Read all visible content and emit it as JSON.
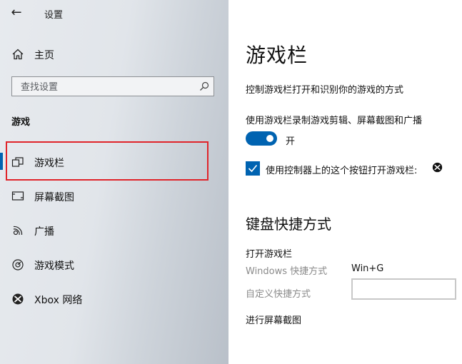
{
  "window": {
    "title": "设置"
  },
  "sidebar": {
    "home_label": "主页",
    "search_placeholder": "查找设置",
    "section_title": "游戏",
    "items": [
      {
        "label": "游戏栏",
        "icon": "game-bar-icon",
        "active": true
      },
      {
        "label": "屏幕截图",
        "icon": "captures-icon"
      },
      {
        "label": "广播",
        "icon": "broadcast-icon"
      },
      {
        "label": "游戏模式",
        "icon": "game-mode-icon"
      },
      {
        "label": "Xbox 网络",
        "icon": "xbox-icon"
      }
    ]
  },
  "content": {
    "title": "游戏栏",
    "description": "控制游戏栏打开和识别你的游戏的方式",
    "toggle_label": "使用游戏栏录制游戏剪辑、屏幕截图和广播",
    "toggle_state": "开",
    "checkbox_label": "使用控制器上的这个按钮打开游戏栏:",
    "shortcuts_heading": "键盘快捷方式",
    "open_game_bar": {
      "heading": "打开游戏栏",
      "windows_shortcut_label": "Windows 快捷方式",
      "windows_shortcut_value": "Win+G",
      "custom_shortcut_label": "自定义快捷方式",
      "custom_shortcut_value": ""
    },
    "next_heading": "进行屏幕截图"
  },
  "colors": {
    "accent": "#0063b1",
    "highlight": "#e0242a"
  }
}
